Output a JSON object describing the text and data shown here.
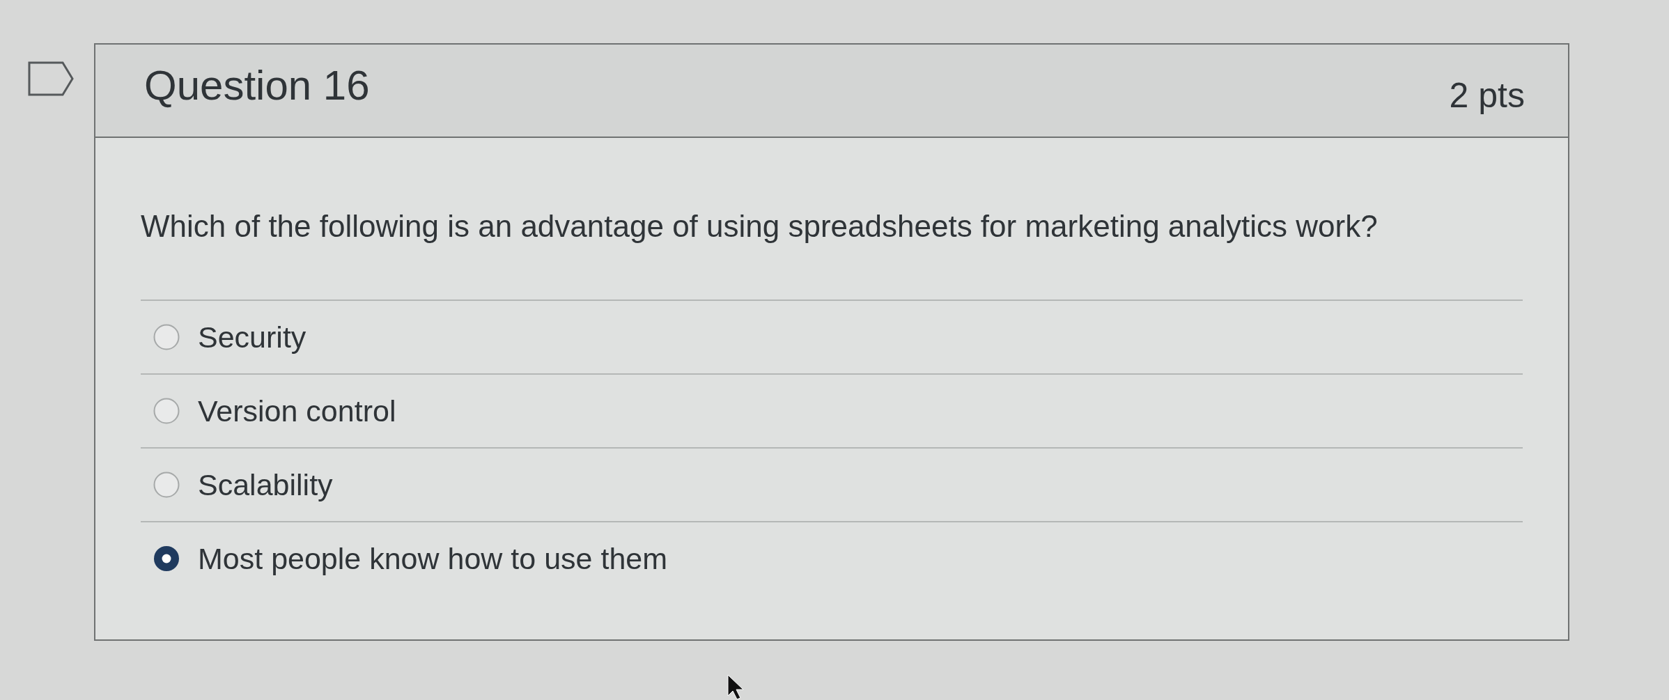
{
  "question": {
    "flagged": false,
    "title": "Question 16",
    "points": "2 pts",
    "text": "Which of the following is an advantage of using spreadsheets for marketing analytics work?",
    "answers": [
      {
        "label": "Security",
        "selected": false
      },
      {
        "label": "Version control",
        "selected": false
      },
      {
        "label": "Scalability",
        "selected": false
      },
      {
        "label": "Most people know how to use them",
        "selected": true
      }
    ]
  }
}
